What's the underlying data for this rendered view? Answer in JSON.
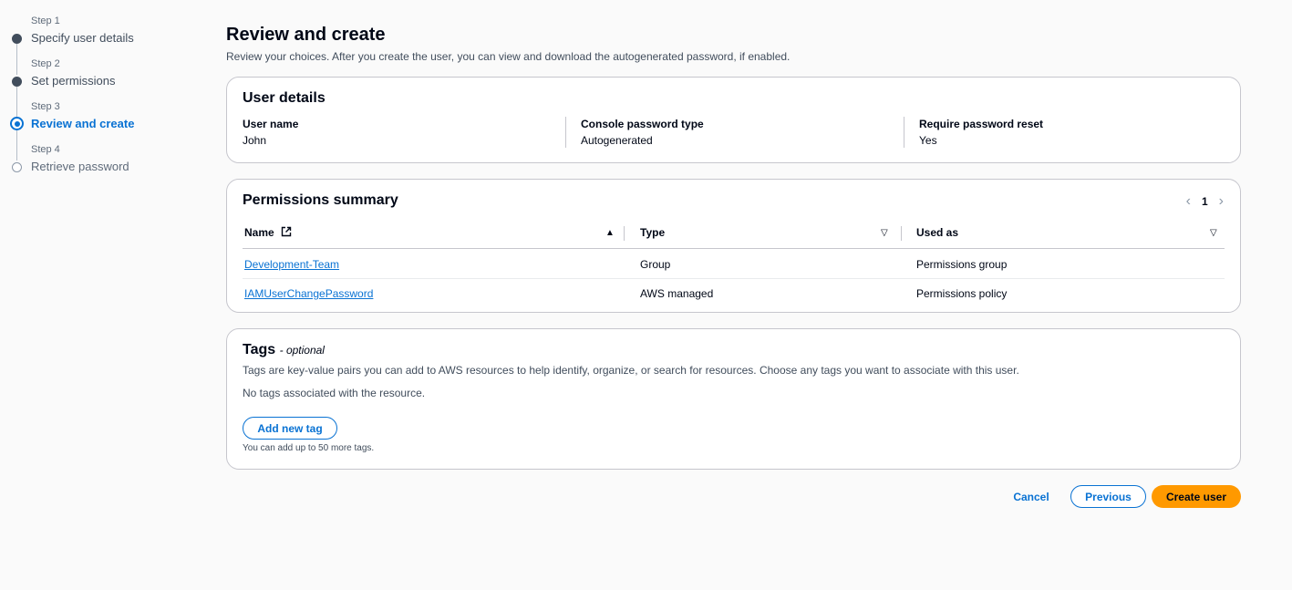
{
  "steps": [
    {
      "number": "Step 1",
      "label": "Specify user details",
      "state": "complete"
    },
    {
      "number": "Step 2",
      "label": "Set permissions",
      "state": "complete"
    },
    {
      "number": "Step 3",
      "label": "Review and create",
      "state": "active"
    },
    {
      "number": "Step 4",
      "label": "Retrieve password",
      "state": "pending"
    }
  ],
  "page": {
    "title": "Review and create",
    "description": "Review your choices. After you create the user, you can view and download the autogenerated password, if enabled."
  },
  "user_details": {
    "title": "User details",
    "fields": [
      {
        "key": "User name",
        "value": "John"
      },
      {
        "key": "Console password type",
        "value": "Autogenerated"
      },
      {
        "key": "Require password reset",
        "value": "Yes"
      }
    ]
  },
  "permissions": {
    "title": "Permissions summary",
    "page_number": "1",
    "columns": [
      "Name",
      "Type",
      "Used as"
    ],
    "rows": [
      {
        "name": "Development-Team",
        "type": "Group",
        "used_as": "Permissions group"
      },
      {
        "name": "IAMUserChangePassword",
        "type": "AWS managed",
        "used_as": "Permissions policy"
      }
    ]
  },
  "tags": {
    "title": "Tags",
    "optional_label": "- optional",
    "description": "Tags are key-value pairs you can add to AWS resources to help identify, organize, or search for resources. Choose any tags you want to associate with this user.",
    "empty_text": "No tags associated with the resource.",
    "add_button": "Add new tag",
    "hint": "You can add up to 50 more tags."
  },
  "actions": {
    "cancel": "Cancel",
    "previous": "Previous",
    "create": "Create user"
  },
  "colors": {
    "accent": "#0972d3",
    "primary_button": "#ff9900"
  }
}
